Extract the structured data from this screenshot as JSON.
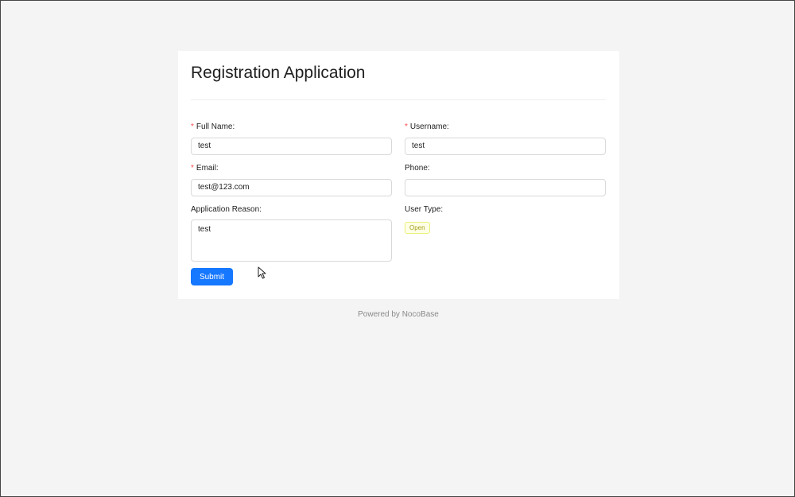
{
  "form": {
    "title": "Registration Application",
    "fields": {
      "full_name": {
        "label": "Full Name:",
        "required": true,
        "value": "test"
      },
      "username": {
        "label": "Username:",
        "required": true,
        "value": "test"
      },
      "email": {
        "label": "Email:",
        "required": true,
        "value": "test@123.com"
      },
      "phone": {
        "label": "Phone:",
        "required": false,
        "value": ""
      },
      "application_reason": {
        "label": "Application Reason:",
        "required": false,
        "value": "test"
      },
      "user_type": {
        "label": "User Type:",
        "required": false,
        "value": "Open"
      }
    },
    "required_marker": "*",
    "submit_label": "Submit"
  },
  "footer": {
    "text": "Powered by NocoBase"
  },
  "colors": {
    "primary": "#1677ff",
    "required": "#ff4d4f",
    "tag_background": "#feffe6",
    "tag_text": "#a8a020",
    "page_background": "#f4f4f4"
  },
  "icons": {
    "cursor": "mouse-pointer-icon"
  }
}
